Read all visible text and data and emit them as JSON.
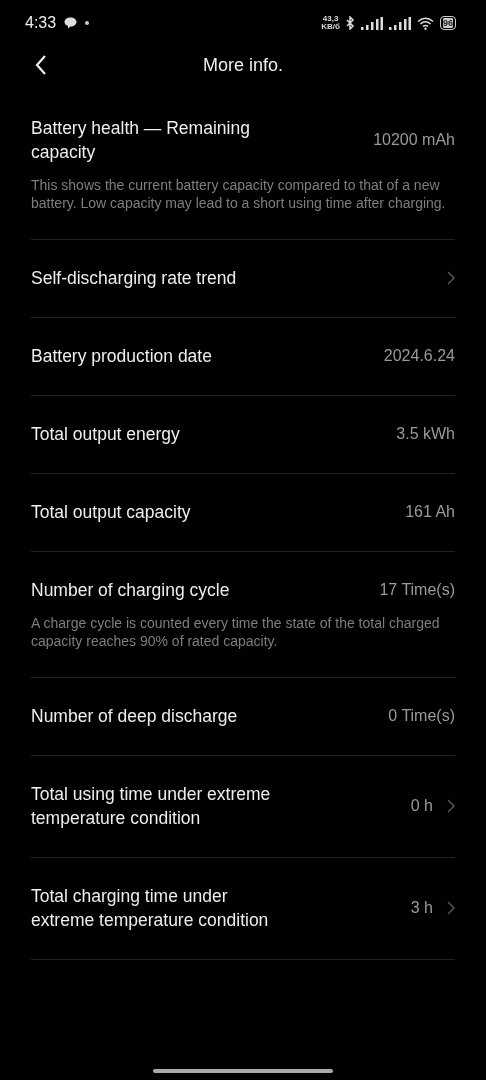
{
  "status_bar": {
    "time": "4:33",
    "speed_value": "43,3",
    "speed_unit": "KB/б",
    "battery": "96"
  },
  "header": {
    "title": "More info."
  },
  "rows": [
    {
      "title": "Battery health — Remaining capacity",
      "value": "10200 mAh",
      "chevron": false,
      "description": "This shows the current battery capacity compared to that of a new battery. Low capacity may lead to a short using time after charging."
    },
    {
      "title": "Self-discharging rate trend",
      "chevron": true
    },
    {
      "title": "Battery production date",
      "value": "2024.6.24",
      "chevron": false
    },
    {
      "title": "Total output energy",
      "value": "3.5 kWh",
      "chevron": false
    },
    {
      "title": "Total output capacity",
      "value": "161 Ah",
      "chevron": false
    },
    {
      "title": "Number of charging cycle",
      "value": "17 Time(s)",
      "chevron": false,
      "description": "A charge cycle is counted every time the state of the total charged capacity reaches 90% of rated capacity."
    },
    {
      "title": "Number of deep discharge",
      "value": "0 Time(s)",
      "chevron": false
    },
    {
      "title": "Total using time under extreme temperature condition",
      "value": "0 h",
      "chevron": true
    },
    {
      "title": "Total charging time under extreme temperature condition",
      "value": "3 h",
      "chevron": true
    }
  ]
}
